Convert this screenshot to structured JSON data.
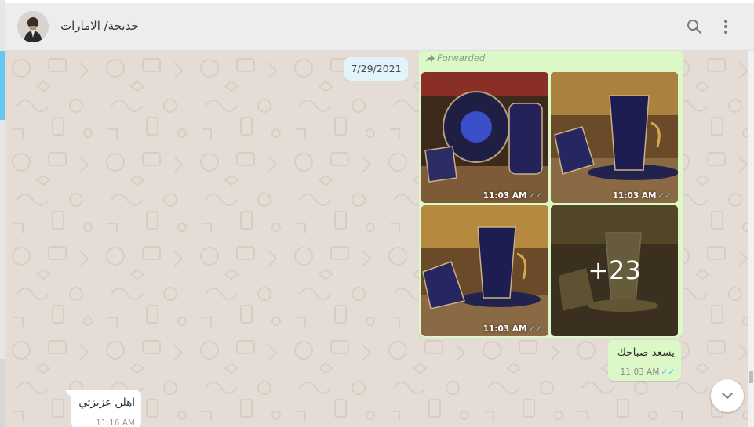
{
  "header": {
    "contact_name": "خديجة/ الامارات",
    "avatar_icon": "avatar",
    "search_icon": "search-icon",
    "menu_icon": "menu-icon"
  },
  "chat": {
    "date_chip": "7/29/2021",
    "album": {
      "forwarded_label": "Forwarded",
      "tiles": [
        {
          "time": "11:03 AM",
          "status": "read"
        },
        {
          "time": "11:03 AM",
          "status": "read"
        },
        {
          "time": "11:03 AM",
          "status": "read"
        },
        {
          "time": "",
          "more_count": "+23"
        }
      ]
    },
    "outgoing_message": {
      "text": "يسعد صباحك",
      "time": "11:03 AM",
      "status": "read"
    },
    "incoming_message": {
      "text": "اهلن عزيزتي",
      "time": "11:16 AM"
    }
  },
  "colors": {
    "chat_bg": "#e5ddd5",
    "outgoing_bubble": "#dcf8c6",
    "incoming_bubble": "#ffffff",
    "date_chip_bg": "#e1f3fb",
    "read_tick": "#4fc3f7",
    "header_bg": "#ededed"
  }
}
